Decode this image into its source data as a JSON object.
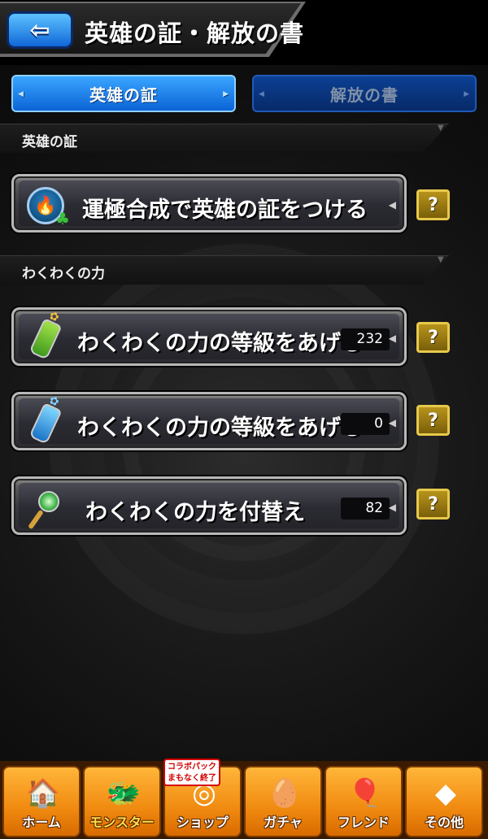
{
  "header": {
    "back_glyph": "⇦",
    "title": "英雄の証・解放の書"
  },
  "tabs": [
    {
      "label": "英雄の証",
      "active": true
    },
    {
      "label": "解放の書",
      "active": false
    }
  ],
  "sections": [
    {
      "label": "英雄の証",
      "rows": [
        {
          "label": "運極合成で英雄の証をつける",
          "icon": "hero-badge-icon",
          "count": null
        }
      ]
    },
    {
      "label": "わくわくの力",
      "rows": [
        {
          "label": "わくわくの力の等級をあげる",
          "icon": "green-bottle-icon",
          "count": "232"
        },
        {
          "label": "わくわくの力の等級をあげる",
          "icon": "blue-bottle-icon",
          "count": "0"
        },
        {
          "label": "わくわくの力を付替え",
          "icon": "wand-icon",
          "count": "82"
        }
      ]
    }
  ],
  "help_label": "?",
  "bottom_nav": {
    "promo": [
      "コラボパック",
      "まもなく終了"
    ],
    "items": [
      {
        "label": "ホーム",
        "icon": "home-icon"
      },
      {
        "label": "モンスター",
        "icon": "monster-icon"
      },
      {
        "label": "ショップ",
        "icon": "shop-icon"
      },
      {
        "label": "ガチャ",
        "icon": "gacha-icon"
      },
      {
        "label": "フレンド",
        "icon": "friend-icon"
      },
      {
        "label": "その他",
        "icon": "other-icon"
      }
    ]
  },
  "colors": {
    "tab_active": "#1f86f0",
    "tab_inactive": "#0a3580",
    "help_gold": "#b7931c",
    "nav_orange": "#f39a1d"
  }
}
